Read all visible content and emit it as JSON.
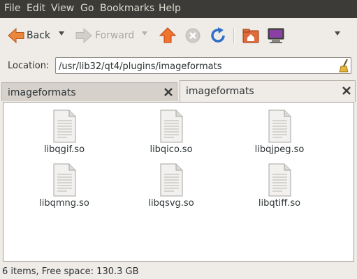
{
  "menubar": {
    "items": [
      "File",
      "Edit",
      "View",
      "Go",
      "Bookmarks",
      "Help"
    ]
  },
  "toolbar": {
    "back_label": "Back",
    "forward_label": "Forward",
    "icons": [
      "back-arrow-icon",
      "forward-arrow-icon",
      "up-arrow-icon",
      "stop-icon",
      "reload-icon",
      "home-folder-icon",
      "computer-icon",
      "overflow-dropdown-icon"
    ]
  },
  "location": {
    "label": "Location:",
    "value": "/usr/lib32/qt4/plugins/imageformats"
  },
  "tabs": [
    {
      "label": "imageformats",
      "active": false
    },
    {
      "label": "imageformats",
      "active": true
    }
  ],
  "files": [
    {
      "name": "libqgif.so"
    },
    {
      "name": "libqico.so"
    },
    {
      "name": "libqjpeg.so"
    },
    {
      "name": "libqmng.so"
    },
    {
      "name": "libqsvg.so"
    },
    {
      "name": "libqtiff.so"
    }
  ],
  "status": {
    "text": "6 items, Free space: 130.3 GB"
  },
  "colors": {
    "menubar_bg": "#3c3b37",
    "window_bg": "#efebe7",
    "accent_orange": "#e95420",
    "reload_blue": "#2f6fc7"
  }
}
